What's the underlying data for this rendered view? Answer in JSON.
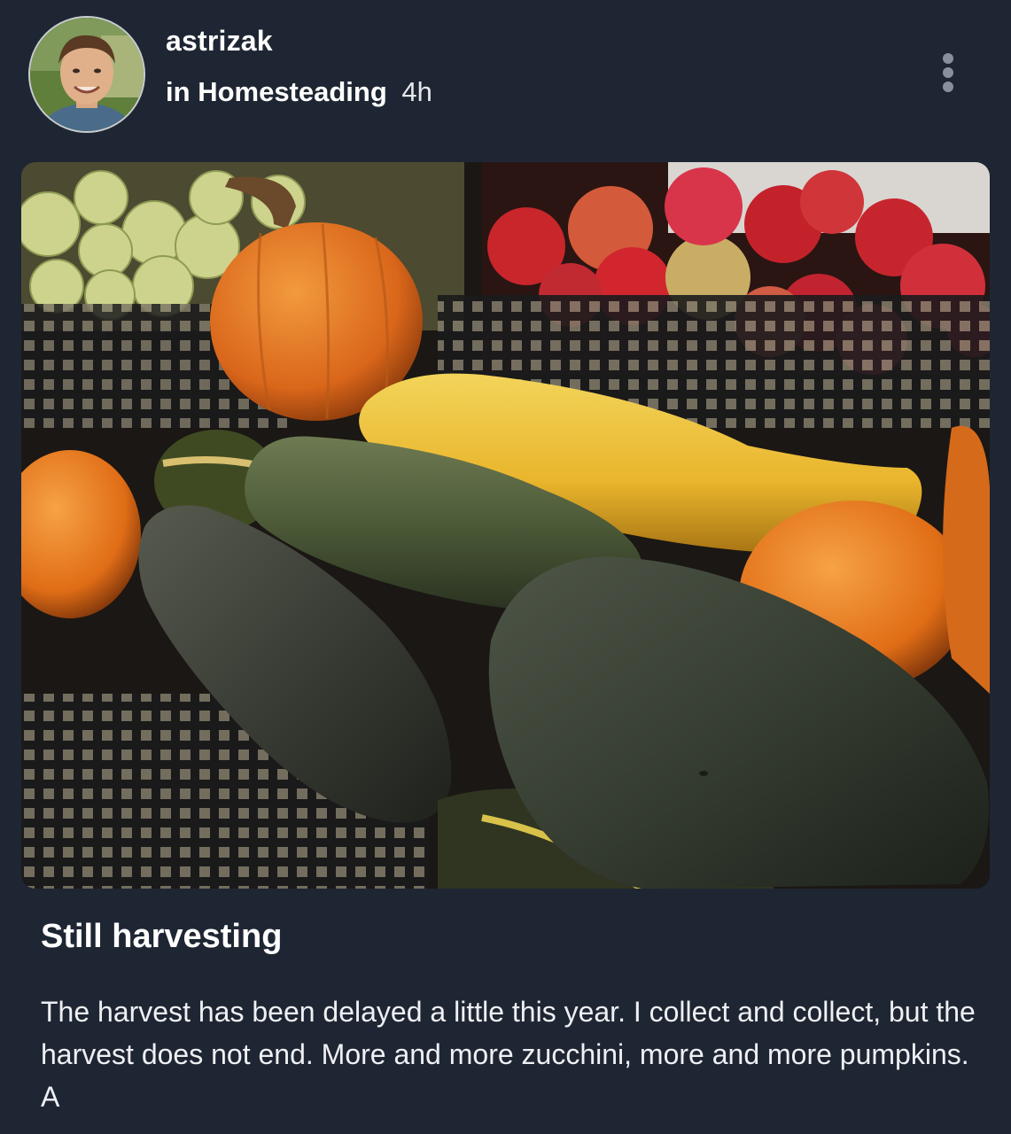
{
  "post": {
    "author": {
      "username": "astrizak",
      "avatar_icon": "user-avatar-icon"
    },
    "meta": {
      "prefix": "in",
      "community": "Homesteading",
      "time": "4h"
    },
    "more_icon": "more-vertical-icon",
    "image_icon": "harvest-photo",
    "title": "Still harvesting",
    "body": "The harvest has been delayed a little this year. I collect and collect, but the harvest does not end. More and more zucchini, more and more pumpkins. A"
  },
  "colors": {
    "background": "#1f2633",
    "text": "#ffffff",
    "muted_icon": "#8a909b"
  }
}
